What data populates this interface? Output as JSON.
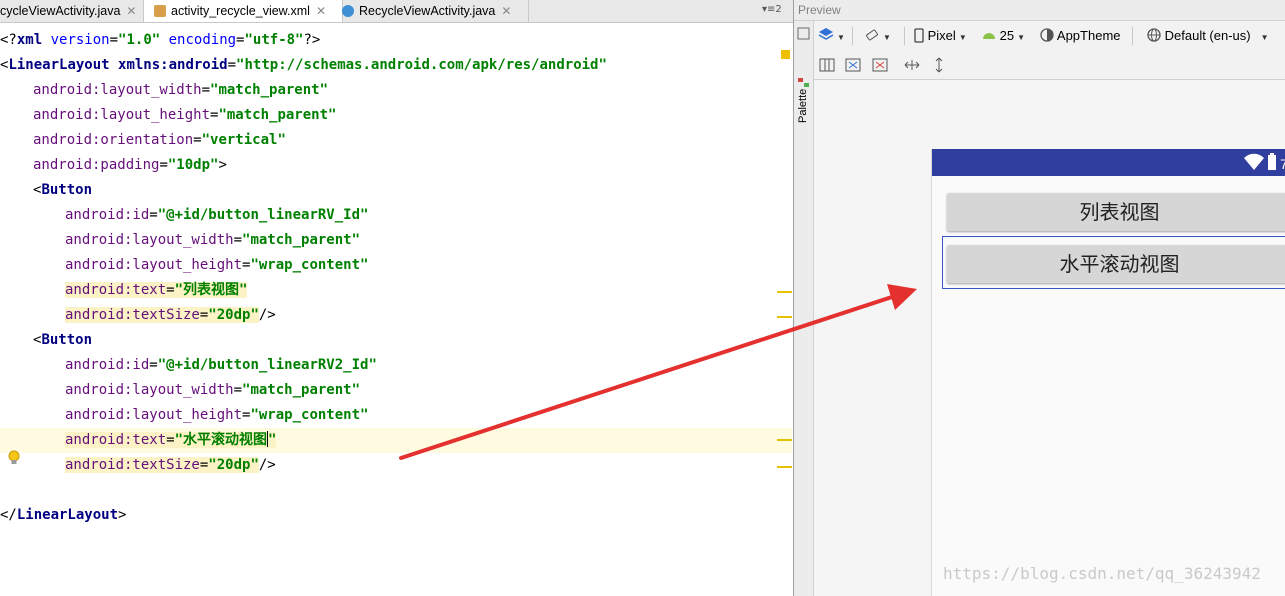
{
  "tabs": [
    {
      "label": "cycleViewActivity.java",
      "active": false
    },
    {
      "label": "activity_recycle_view.xml",
      "active": true
    },
    {
      "label": "RecycleViewActivity.java",
      "active": false
    }
  ],
  "tab_overflow": "2",
  "code": {
    "l1": {
      "open": "<?",
      "kw": "xml",
      "a1": " version",
      "eq1": "=",
      "v1": "\"1.0\"",
      "a2": " encoding",
      "eq2": "=",
      "v2": "\"utf-8\"",
      "close": "?>"
    },
    "l2": {
      "open": "<",
      "tag": "LinearLayout",
      "a": " xmlns:android",
      "eq": "=",
      "v": "\"http://schemas.android.com/apk/res/android\""
    },
    "l3": {
      "a": "android:layout_width",
      "eq": "=",
      "v": "\"match_parent\""
    },
    "l4": {
      "a": "android:layout_height",
      "eq": "=",
      "v": "\"match_parent\""
    },
    "l5": {
      "a": "android:orientation",
      "eq": "=",
      "v": "\"vertical\""
    },
    "l6": {
      "a": "android:padding",
      "eq": "=",
      "v": "\"10dp\"",
      "close": ">"
    },
    "l7": {
      "open": "<",
      "tag": "Button"
    },
    "l8": {
      "a": "android:id",
      "eq": "=",
      "v": "\"@+id/button_linearRV_Id\""
    },
    "l9": {
      "a": "android:layout_width",
      "eq": "=",
      "v": "\"match_parent\""
    },
    "l10": {
      "a": "android:layout_height",
      "eq": "=",
      "v": "\"wrap_content\""
    },
    "l11": {
      "a": "android:text",
      "eq": "=",
      "v": "\"列表视图\""
    },
    "l12": {
      "a": "android:textSize",
      "eq": "=",
      "v": "\"20dp\"",
      "close": "/>"
    },
    "l13": {
      "open": "<",
      "tag": "Button"
    },
    "l14": {
      "a": "android:id",
      "eq": "=",
      "v": "\"@+id/button_linearRV2_Id\""
    },
    "l15": {
      "a": "android:layout_width",
      "eq": "=",
      "v": "\"match_parent\""
    },
    "l16": {
      "a": "android:layout_height",
      "eq": "=",
      "v": "\"wrap_content\""
    },
    "l17": {
      "a": "android:text",
      "eq": "=",
      "v1": "\"水平滚动视图",
      "v2": "\""
    },
    "l18": {
      "a": "android:textSize",
      "eq": "=",
      "v": "\"20dp\"",
      "close": "/>"
    },
    "l20": {
      "open": "</",
      "tag": "LinearLayout",
      "close": ">"
    }
  },
  "preview": {
    "title": "Preview",
    "palette_label": "Palette",
    "toolbar": {
      "device": "Pixel",
      "api": "25",
      "theme": "AppTheme",
      "locale": "Default (en-us)"
    },
    "buttons": [
      "列表视图",
      "水平滚动视图"
    ]
  },
  "watermark": "https://blog.csdn.net/qq_36243942",
  "colors": {
    "status_bar": "#303f9f",
    "arrow": "#e53030",
    "selection": "#3b55c8"
  }
}
